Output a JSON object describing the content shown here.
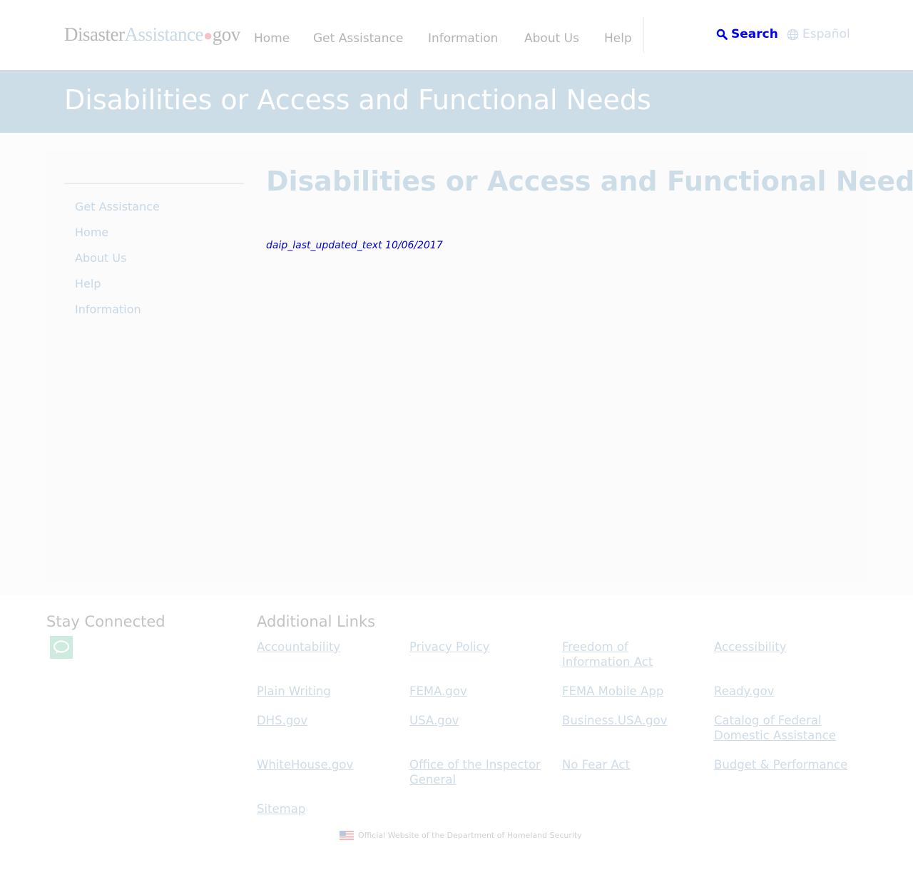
{
  "header": {
    "logo": {
      "part1": "Disaster",
      "part2": "Assistance",
      "dot": "●",
      "part3": "gov"
    },
    "nav": [
      "Home",
      "Get Assistance",
      "Information",
      "About Us",
      "Help"
    ],
    "search_label": "Search",
    "language_label": "Español"
  },
  "banner": {
    "title": "Disabilities or Access and Functional Needs"
  },
  "sidebar": {
    "items": [
      "Get Assistance",
      "Home",
      "About Us",
      "Help",
      "Information"
    ]
  },
  "main": {
    "heading": "Disabilities or Access and Functional Needs",
    "last_updated": "daip_last_updated_text 10/06/2017"
  },
  "footer": {
    "stay_connected_heading": "Stay Connected",
    "additional_links_heading": "Additional Links",
    "links": [
      "Accountability",
      "Privacy Policy",
      "Freedom of Information Act",
      "Accessibility",
      "Plain Writing",
      "FEMA.gov",
      "FEMA Mobile App",
      "Ready.gov",
      "DHS.gov",
      "USA.gov",
      "Business.USA.gov",
      "Catalog of Federal Domestic Assistance",
      "WhiteHouse.gov",
      "Office of the Inspector General",
      "No Fear Act",
      "Budget & Performance",
      "Sitemap"
    ],
    "dhs_text": "Official Website of the Department of Homeland Security"
  },
  "colors": {
    "banner": "#cddde7",
    "link_blue": "#0000ee",
    "faded_link": "#cfdce7",
    "chat_green": "#cfeadf"
  },
  "icons": [
    "search-icon",
    "globe-icon",
    "chat-icon",
    "us-flag-icon"
  ]
}
